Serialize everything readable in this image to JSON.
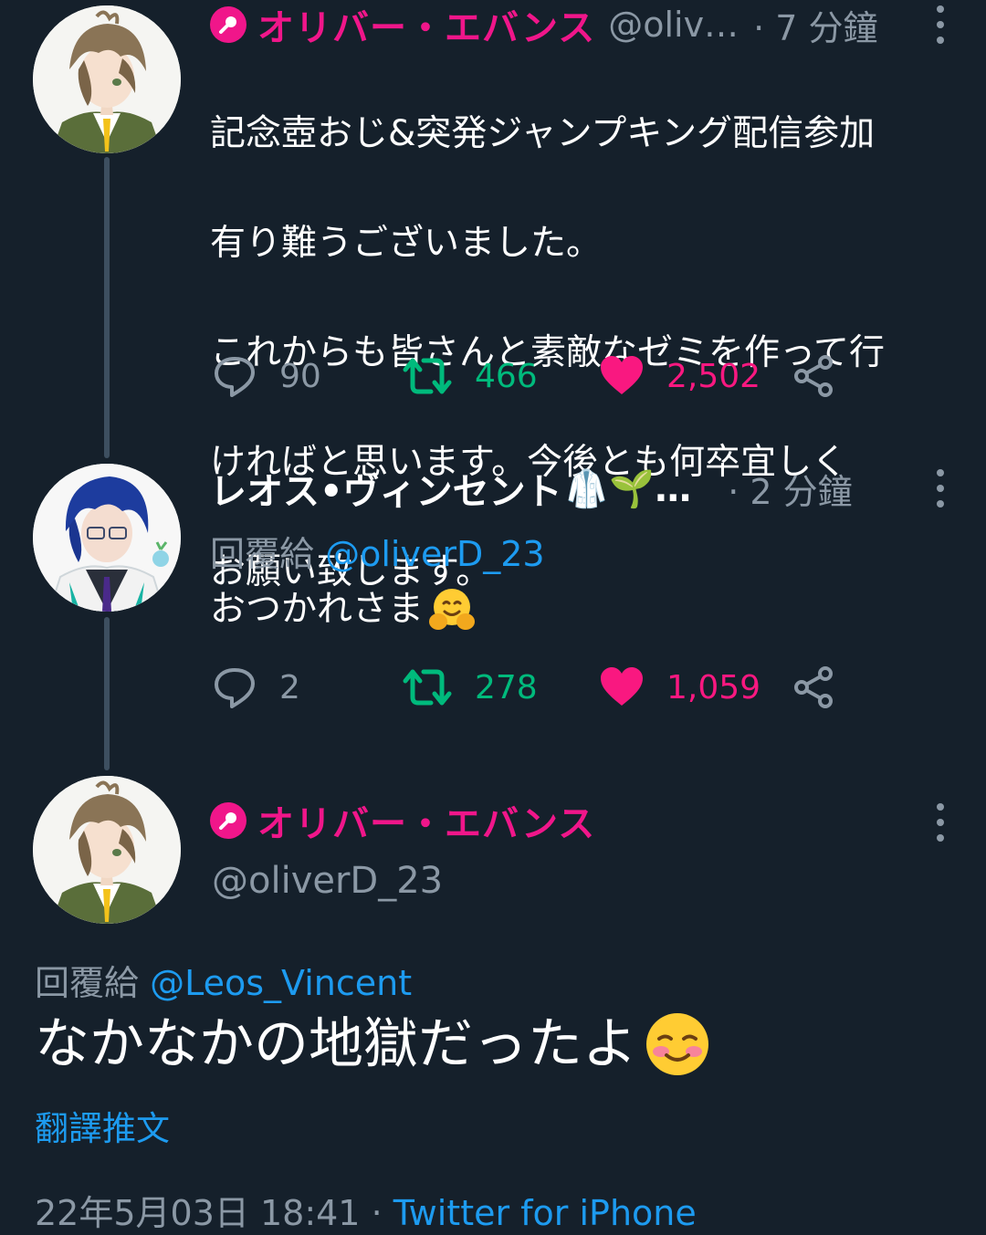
{
  "colors": {
    "background": "#15202b",
    "oshi_pink": "#f0168a",
    "muted": "#8b98a5",
    "link": "#1d9bf0",
    "retweet": "#00ba7c",
    "like": "#f91880"
  },
  "tweets": [
    {
      "name": "オリバー・エバンス",
      "handle": "@oliv…",
      "time": "· 7 分鐘",
      "text_lines": [
        "記念壺おじ&突発ジャンプキング配信参加",
        "有り難うございました。",
        "これからも皆さんと素敵なゼミを作って行",
        "ければと思います。今後とも何卒宜しく",
        "お願い致します。"
      ],
      "replies": "90",
      "retweets": "466",
      "likes": "2,502"
    },
    {
      "name": "レオス•ヴィンセント",
      "name_emoji": "🥼🌱…",
      "time": "· 2 分鐘",
      "reply_prefix": "回覆給",
      "reply_mention": "@oliverD_23",
      "text": "おつかれさま",
      "text_emoji": "hugging-face",
      "replies": "2",
      "retweets": "278",
      "likes": "1,059"
    }
  ],
  "focused": {
    "name": "オリバー・エバンス",
    "handle": "@oliverD_23",
    "reply_prefix": "回覆給",
    "reply_mention": "@Leos_Vincent",
    "text": "なかなかの地獄だったよ",
    "text_emoji": "smiling-face-blush",
    "translate_label": "翻譯推文",
    "date": "22年5月03日 18:41",
    "separator": " · ",
    "source": "Twitter for iPhone"
  }
}
